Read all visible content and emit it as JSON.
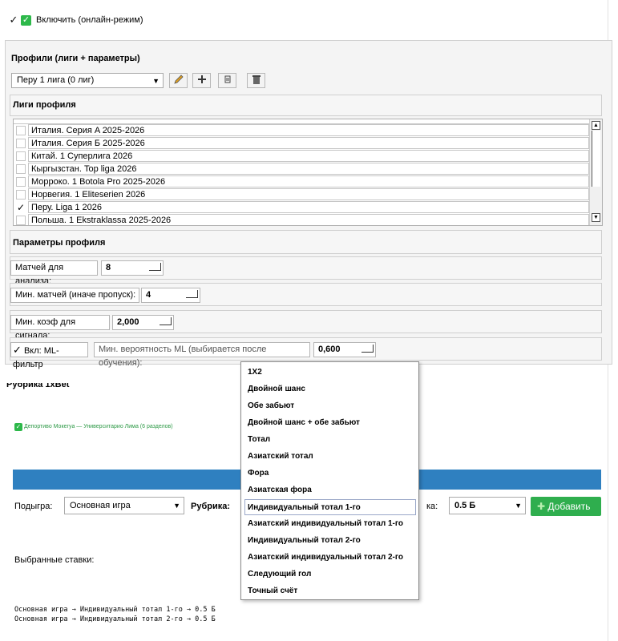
{
  "top": {
    "enable_label": "Включить (онлайн-режим)"
  },
  "profiles": {
    "title": "Профили  (лиги + параметры)",
    "selected_profile": "Перу 1 лига (0 лиг)",
    "leagues_header": "Лиги профиля",
    "leagues": [
      {
        "label": "Италия. Серия A 2025-2026",
        "checked": false
      },
      {
        "label": "Италия. Серия Б 2025-2026",
        "checked": false
      },
      {
        "label": "Китай. 1 Суперлига 2026",
        "checked": false
      },
      {
        "label": "Кыргызстан. Top liga 2026",
        "checked": false
      },
      {
        "label": "Морроко. 1 Botola Pro 2025-2026",
        "checked": false
      },
      {
        "label": "Норвегия. 1 Eliteserien 2026",
        "checked": false
      },
      {
        "label": "Перу. Liga 1 2026",
        "checked": true
      },
      {
        "label": "Польша. 1 Ekstraklassa 2025-2026",
        "checked": false
      }
    ],
    "params_header": "Параметры профиля",
    "matches_label": "Матчей для анализа:",
    "matches_value": "8",
    "min_matches_label": "Мин. матчей (иначе пропуск):",
    "min_matches_value": "4",
    "min_coef_label": "Мин. коэф для сигнала:",
    "min_coef_value": "2,000",
    "ml_filter_label": "Вкл: ML-фильтр",
    "ml_prob_label": "Мин. вероятность ML (выбирается после обучения):",
    "ml_prob_value": "0,600"
  },
  "rubric_partial": "Рубрика 1xBet",
  "match_line": "Депортиво Мокегуа — Университарио Лима  (6 разделов)",
  "controls": {
    "subgame_label": "Подыгра:",
    "subgame_value": "Основная игра",
    "rubric_label": "Рубрика:",
    "line_label_partial": "ка:",
    "line_value": "0.5 Б",
    "add_button": "Добавить"
  },
  "selected_bets_label": "Выбранные ставки:",
  "selected_bets": [
    "Основная игра → Индивидуальный тотал 1-го → 0.5 Б",
    "Основная игра → Индивидуальный тотал 2-го → 0.5 Б"
  ],
  "rubric_dropdown": {
    "items": [
      "1X2",
      "Двойной шанс",
      "Обе забьют",
      "Двойной шанс + обе забьют",
      "Тотал",
      "Азиатский тотал",
      "Фора",
      "Азиатская фора",
      "Индивидуальный тотал 1-го",
      "Азиатский индивидуальный тотал 1-го",
      "Индивидуальный тотал 2-го",
      "Азиатский индивидуальный тотал 2-го",
      "Следующий гол",
      "Точный счёт"
    ],
    "highlighted": "Индивидуальный тотал 1-го"
  },
  "colors": {
    "accent_bar": "#2f80c0",
    "add_button": "#2fae4e",
    "check_green": "#2db84a"
  }
}
